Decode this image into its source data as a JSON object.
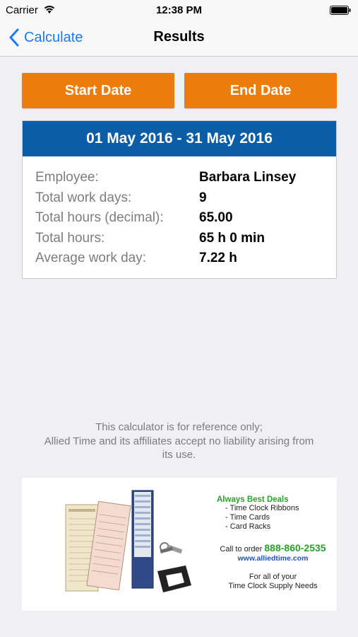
{
  "status_bar": {
    "carrier": "Carrier",
    "time": "12:38 PM"
  },
  "nav": {
    "back_label": "Calculate",
    "title": "Results"
  },
  "buttons": {
    "start_date": "Start Date",
    "end_date": "End Date"
  },
  "results": {
    "range": "01 May 2016 - 31 May 2016",
    "rows": [
      {
        "label": "Employee:",
        "value": "Barbara Linsey"
      },
      {
        "label": "Total work days:",
        "value": "9"
      },
      {
        "label": "Total hours (decimal):",
        "value": "65.00"
      },
      {
        "label": "Total hours:",
        "value": "65 h 0 min"
      },
      {
        "label": "Average work day:",
        "value": "7.22 h"
      }
    ]
  },
  "disclaimer": {
    "line1": "This calculator is for reference only;",
    "line2": "Allied Time and its affiliates accept no liability arising from",
    "line3": "its use."
  },
  "ad": {
    "headline": "Always Best Deals",
    "items": [
      "- Time Clock Ribbons",
      "- Time Cards",
      "- Card Racks"
    ],
    "order_prefix": "Call to order",
    "phone": "888-860-2535",
    "url": "www.alliedtime.com",
    "footer_line1": "For all of your",
    "footer_line2": "Time Clock Supply Needs"
  },
  "colors": {
    "accent_orange": "#ec7d0c",
    "header_blue": "#0b5da7",
    "link_blue": "#1a7cf5",
    "ad_green": "#2aa12a"
  }
}
